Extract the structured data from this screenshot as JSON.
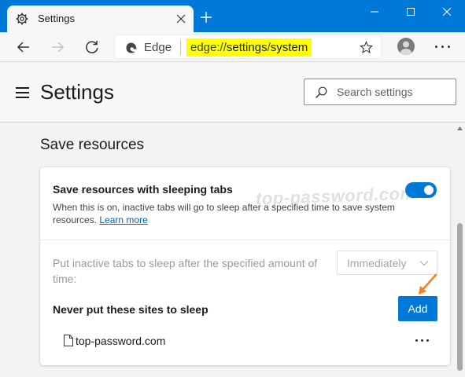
{
  "window": {
    "tab_title": "Settings",
    "tab_icon": "gear-icon",
    "new_tab_icon": "plus-icon",
    "controls": [
      "minimize-icon",
      "maximize-icon",
      "close-icon"
    ]
  },
  "toolbar": {
    "back_icon": "back-arrow-icon",
    "forward_icon": "forward-arrow-icon",
    "refresh_icon": "refresh-icon",
    "browser_label": "Edge",
    "url": {
      "prefix": "edge://",
      "part1": "settings",
      "sep": "/",
      "part2": "system"
    },
    "favorite_icon": "star-icon",
    "profile_icon": "avatar-icon",
    "menu_icon": "more-icon"
  },
  "header": {
    "menu_icon": "hamburger-icon",
    "title": "Settings",
    "search_placeholder": "Search settings"
  },
  "section": {
    "title": "Save resources",
    "sleeping_tabs": {
      "title": "Save resources with sleeping tabs",
      "description": "When this is on, inactive tabs will go to sleep after a specified time to save system resources.",
      "learn_more": "Learn more",
      "enabled": true
    },
    "sleep_after": {
      "label": "Put inactive tabs to sleep after the specified amount of time:",
      "selected": "Immediately"
    },
    "never_sleep": {
      "label": "Never put these sites to sleep",
      "add_label": "Add",
      "sites": [
        "top-password.com"
      ]
    }
  },
  "watermark": "top-password.com",
  "colors": {
    "accent": "#0078d7",
    "url_highlight": "#ffff00",
    "annotation_arrow": "#f58220"
  }
}
